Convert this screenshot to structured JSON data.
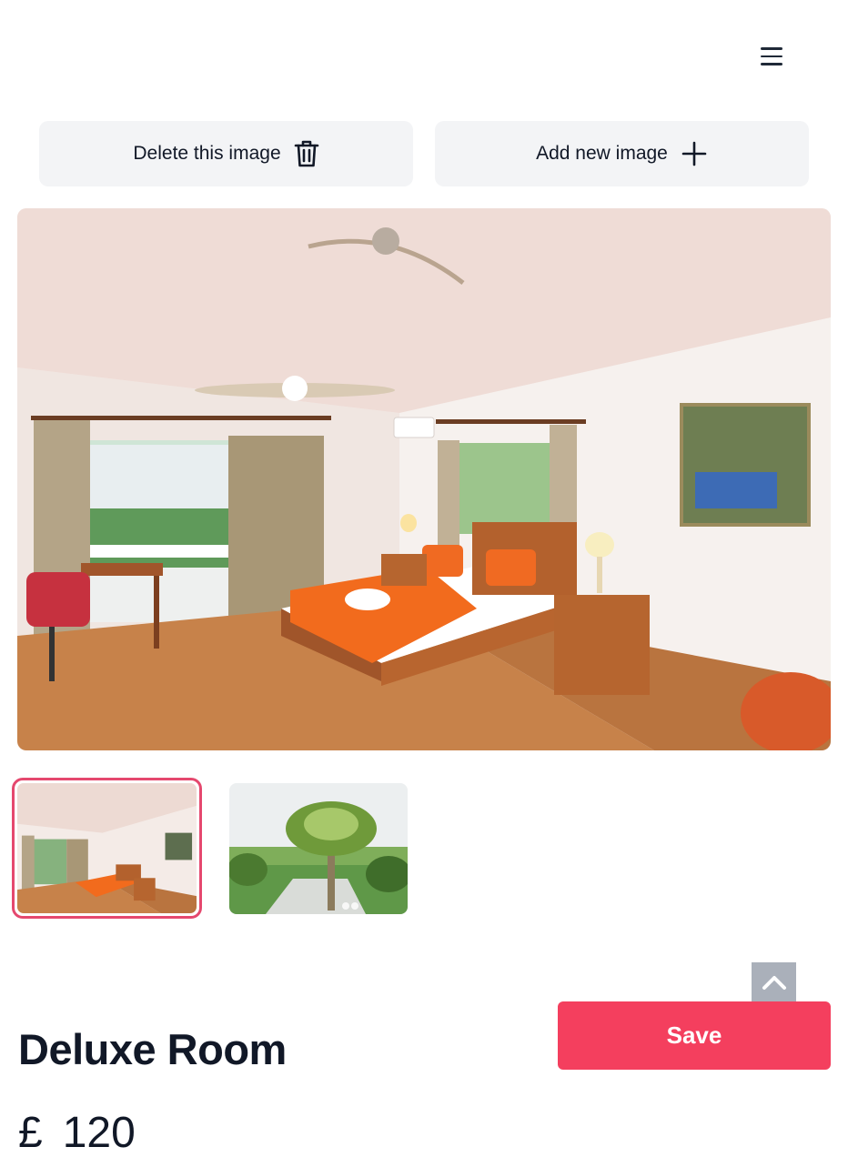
{
  "header": {
    "menu_icon": "hamburger-menu-icon"
  },
  "toolbar": {
    "delete_label": "Delete this image",
    "delete_icon": "trash-icon",
    "add_label": "Add new image",
    "add_icon": "plus-icon"
  },
  "gallery": {
    "thumbnails": [
      {
        "selected": true
      },
      {
        "selected": false
      }
    ],
    "accent_color": "#e5486e"
  },
  "scroll_top_icon": "chevron-up-icon",
  "save_label": "Save",
  "save_color": "#f43f5e",
  "room": {
    "title": "Deluxe Room",
    "currency": "£",
    "price": "120"
  }
}
